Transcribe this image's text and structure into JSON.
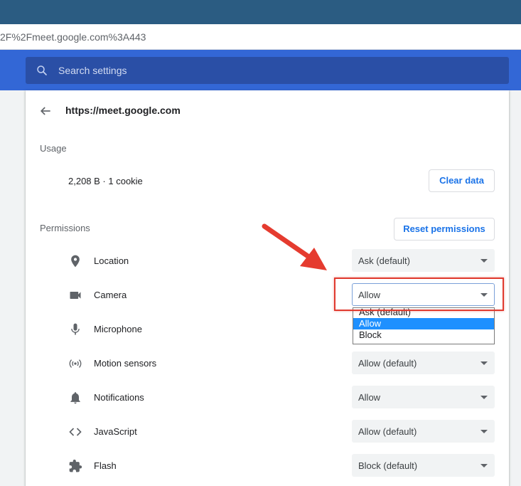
{
  "address_bar": {
    "url_fragment": "2F%2Fmeet.google.com%3A443"
  },
  "search": {
    "placeholder": "Search settings"
  },
  "site": {
    "url": "https://meet.google.com"
  },
  "usage": {
    "heading": "Usage",
    "summary": "2,208 B · 1 cookie",
    "clear_button": "Clear data"
  },
  "permissions": {
    "heading": "Permissions",
    "reset_button": "Reset permissions",
    "items": [
      {
        "label": "Location",
        "value": "Ask (default)",
        "icon": "location-pin-icon"
      },
      {
        "label": "Camera",
        "value": "Allow",
        "icon": "camera-icon"
      },
      {
        "label": "Microphone",
        "value": "",
        "icon": "microphone-icon"
      },
      {
        "label": "Motion sensors",
        "value": "Allow (default)",
        "icon": "motion-sensors-icon"
      },
      {
        "label": "Notifications",
        "value": "Allow",
        "icon": "bell-icon"
      },
      {
        "label": "JavaScript",
        "value": "Allow (default)",
        "icon": "code-icon"
      },
      {
        "label": "Flash",
        "value": "Block (default)",
        "icon": "puzzle-piece-icon"
      }
    ],
    "camera_dropdown_options": [
      "Ask (default)",
      "Allow",
      "Block"
    ],
    "camera_dropdown_selected": "Allow"
  },
  "colors": {
    "title_bar": "#2b5c82",
    "settings_header": "#3367d6",
    "search_box": "#2a4fa6",
    "link_blue": "#1a73e8",
    "annotation_red": "#e03a2f",
    "option_selected": "#1e90ff"
  }
}
